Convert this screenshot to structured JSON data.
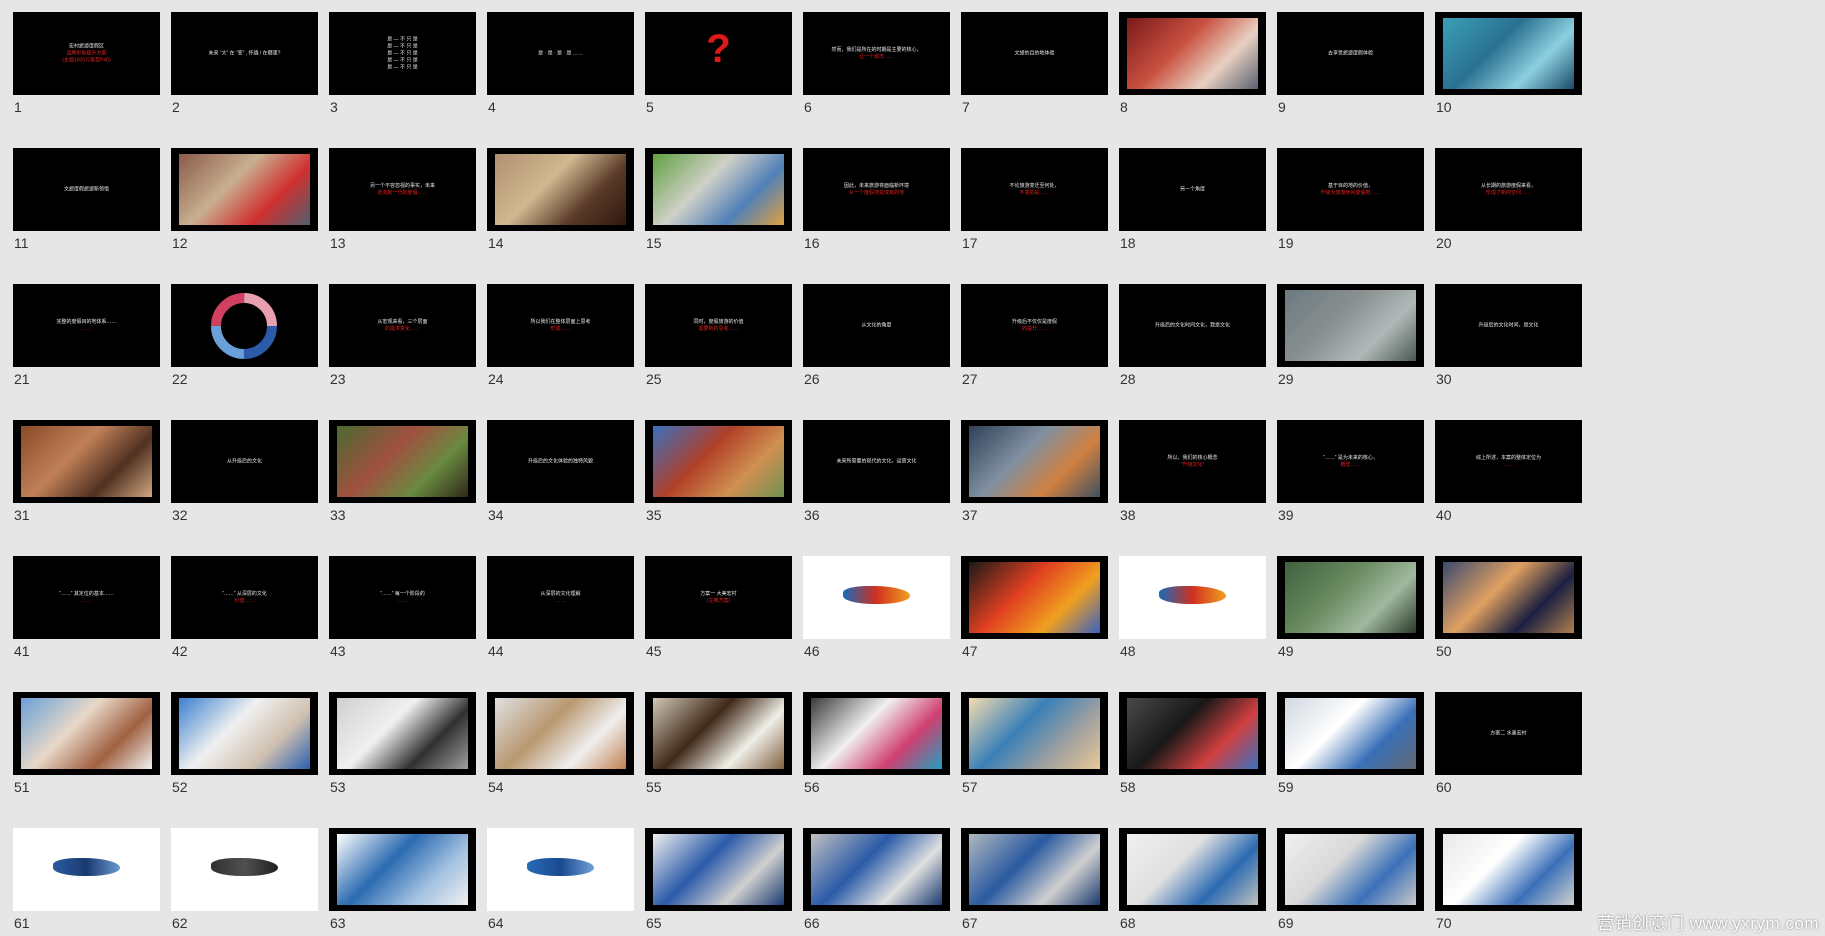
{
  "slides": [
    {
      "n": "1",
      "kind": "text",
      "lines": [
        "宏村旅游度假区",
        "品牌形象提升方案",
        "(主题1000万案至P40)"
      ]
    },
    {
      "n": "2",
      "kind": "text",
      "lines": [
        "未来 “大” 在 “变” , 怀缅 / 在哪里?"
      ]
    },
    {
      "n": "3",
      "kind": "text",
      "lines": [
        "是 — 不 只 是",
        "是 — 不 只 是",
        "是 — 不 只 是",
        "是 — 不 只 是",
        "是 — 不 只 是"
      ]
    },
    {
      "n": "4",
      "kind": "text",
      "lines": [
        "是 · 是 · 是 · 是 ……"
      ]
    },
    {
      "n": "5",
      "kind": "question",
      "lines": [
        "?"
      ]
    },
    {
      "n": "6",
      "kind": "text",
      "lines": [
        "然而，我们是所在的时期是主要的核心，",
        "让一个城市……"
      ]
    },
    {
      "n": "7",
      "kind": "text",
      "lines": [
        "文旅的目的地体验"
      ]
    },
    {
      "n": "8",
      "kind": "photo",
      "colors": [
        "#7a1a1a",
        "#c85040",
        "#e8d0c0",
        "#5a6070"
      ]
    },
    {
      "n": "9",
      "kind": "text",
      "lines": [
        "去享受旅游度假体验"
      ]
    },
    {
      "n": "10",
      "kind": "photo",
      "colors": [
        "#3aa0b8",
        "#2a7090",
        "#8cd0e0",
        "#1a4a68"
      ]
    },
    {
      "n": "11",
      "kind": "text",
      "lines": [
        "文旅度假旅游新领悟"
      ]
    },
    {
      "n": "12",
      "kind": "photo",
      "colors": [
        "#8a5a4a",
        "#c8b090",
        "#d03030",
        "#506070"
      ]
    },
    {
      "n": "13",
      "kind": "text",
      "lines": [
        "另一个不容忽视的事实，未来",
        "走向新一代的度假……"
      ]
    },
    {
      "n": "14",
      "kind": "photo",
      "colors": [
        "#b09070",
        "#d0b890",
        "#5a3a28",
        "#301810"
      ]
    },
    {
      "n": "15",
      "kind": "photo",
      "colors": [
        "#60a040",
        "#d0d0c8",
        "#5080b8",
        "#e0a040"
      ]
    },
    {
      "n": "16",
      "kind": "text",
      "lines": [
        "因此，未来旅游将面临新环境",
        "从一个度假地变成目的地"
      ]
    },
    {
      "n": "17",
      "kind": "text",
      "lines": [
        "不论旅游变迁至何处，",
        "不变的是……"
      ]
    },
    {
      "n": "18",
      "kind": "text",
      "lines": [
        "另一个角度"
      ]
    },
    {
      "n": "19",
      "kind": "text",
      "lines": [
        "基于目的地的价值，",
        "升级为旅游休闲度假地……"
      ]
    },
    {
      "n": "20",
      "kind": "text",
      "lines": [
        "从长期的旅游度假来看，",
        "形成了新的空间……"
      ]
    },
    {
      "n": "21",
      "kind": "text",
      "lines": [
        "完整的度假目的地体系……",
        "……"
      ]
    },
    {
      "n": "22",
      "kind": "donut",
      "colors": [
        "#2a5aa8",
        "#6aa0d8",
        "#d04060",
        "#e8a0b0"
      ]
    },
    {
      "n": "23",
      "kind": "text",
      "lines": [
        "从宏观来看，三个层面",
        "的需求变化……"
      ]
    },
    {
      "n": "24",
      "kind": "text",
      "lines": [
        "所以我们在整体层面上思考",
        "形成……"
      ]
    },
    {
      "n": "25",
      "kind": "text",
      "lines": [
        "同时，度假旅游的价值",
        "需要新的思考……"
      ]
    },
    {
      "n": "26",
      "kind": "text",
      "lines": [
        "从文化的角度"
      ]
    },
    {
      "n": "27",
      "kind": "text",
      "lines": [
        "升级后不仅仅是度假",
        "的提升……"
      ]
    },
    {
      "n": "28",
      "kind": "text",
      "lines": [
        "升级后的文化时间文化，我是文化"
      ]
    },
    {
      "n": "29",
      "kind": "photo",
      "colors": [
        "#6a7a80",
        "#8a9090",
        "#b0b8b8",
        "#4a5a50"
      ]
    },
    {
      "n": "30",
      "kind": "text",
      "lines": [
        "升级后的文化时间，是文化"
      ]
    },
    {
      "n": "31",
      "kind": "photo",
      "colors": [
        "#8a4a28",
        "#c08058",
        "#503020",
        "#d0a880"
      ]
    },
    {
      "n": "32",
      "kind": "text",
      "lines": [
        "从升级后的文化"
      ]
    },
    {
      "n": "33",
      "kind": "photo",
      "colors": [
        "#4a6a30",
        "#a05040",
        "#6a8a40",
        "#302818"
      ]
    },
    {
      "n": "34",
      "kind": "text",
      "lines": [
        "升级后的文化体验的独特风貌"
      ]
    },
    {
      "n": "35",
      "kind": "photo",
      "colors": [
        "#3a70c0",
        "#b04028",
        "#d09050",
        "#709050"
      ]
    },
    {
      "n": "36",
      "kind": "text",
      "lines": [
        "未来所需要的现代的文化，运营文化"
      ]
    },
    {
      "n": "37",
      "kind": "photo",
      "colors": [
        "#304058",
        "#8090a0",
        "#d08040",
        "#405060"
      ]
    },
    {
      "n": "38",
      "kind": "text",
      "lines": [
        "所以，我们的核心概念",
        "“升级文化”"
      ]
    },
    {
      "n": "39",
      "kind": "text",
      "lines": [
        "“……” 是为未来的核心，",
        "概念……"
      ]
    },
    {
      "n": "40",
      "kind": "text",
      "lines": [
        "综上所述，本案的整体定位为",
        "……"
      ]
    },
    {
      "n": "41",
      "kind": "text",
      "lines": [
        "“……” 其定位的基本……",
        "……"
      ]
    },
    {
      "n": "42",
      "kind": "text",
      "lines": [
        "“……” 从深层的文化",
        "价值……"
      ]
    },
    {
      "n": "43",
      "kind": "text",
      "lines": [
        "“……” 每一个阶段的",
        "……"
      ]
    },
    {
      "n": "44",
      "kind": "text",
      "lines": [
        "从深层的文化理解",
        "……"
      ]
    },
    {
      "n": "45",
      "kind": "text",
      "lines": [
        "方案一 大美宏村",
        "(主推方案)"
      ]
    },
    {
      "n": "46",
      "kind": "logo-white",
      "colors": [
        "#1a6ab8",
        "#d03020",
        "#f0a020"
      ]
    },
    {
      "n": "47",
      "kind": "photo",
      "colors": [
        "#1a1a1a",
        "#e04020",
        "#f0a020",
        "#3a60c0"
      ]
    },
    {
      "n": "48",
      "kind": "logo-white",
      "colors": [
        "#1a6ab8",
        "#d03020",
        "#f0a020"
      ]
    },
    {
      "n": "49",
      "kind": "photo",
      "colors": [
        "#406040",
        "#6a8a60",
        "#a0b8a0",
        "#2a3a28"
      ]
    },
    {
      "n": "50",
      "kind": "photo",
      "colors": [
        "#3a4a70",
        "#e0a060",
        "#1a2040",
        "#b08050"
      ]
    },
    {
      "n": "51",
      "kind": "photo",
      "colors": [
        "#6aa0d8",
        "#e8d8c8",
        "#a06040",
        "#f0f0f0"
      ]
    },
    {
      "n": "52",
      "kind": "photo",
      "colors": [
        "#3a80d0",
        "#f0f0f0",
        "#d0c0b0",
        "#2a60b0"
      ]
    },
    {
      "n": "53",
      "kind": "photo",
      "colors": [
        "#d0d0d0",
        "#f0f0f0",
        "#303030",
        "#a0a0a0"
      ]
    },
    {
      "n": "54",
      "kind": "photo",
      "colors": [
        "#e0e0e0",
        "#b89870",
        "#f0f0f0",
        "#c08050"
      ]
    },
    {
      "n": "55",
      "kind": "photo",
      "colors": [
        "#d0c8b8",
        "#402818",
        "#f0f0e8",
        "#806040"
      ]
    },
    {
      "n": "56",
      "kind": "photo",
      "colors": [
        "#3a3a3a",
        "#f0f0f0",
        "#d04070",
        "#20a0c0"
      ]
    },
    {
      "n": "57",
      "kind": "photo",
      "colors": [
        "#f5dcb0",
        "#3a80b8",
        "#a0a0a0",
        "#e8c898"
      ]
    },
    {
      "n": "58",
      "kind": "photo",
      "colors": [
        "#4a4a4a",
        "#181818",
        "#d04040",
        "#3a70c0"
      ]
    },
    {
      "n": "59",
      "kind": "photo",
      "colors": [
        "#d0d8e0",
        "#ffffff",
        "#3a70b8",
        "#606870"
      ]
    },
    {
      "n": "60",
      "kind": "text",
      "lines": [
        "方案二 水墨宏村"
      ]
    },
    {
      "n": "61",
      "kind": "logo-white",
      "colors": [
        "#2a5aa0",
        "#1a3a70",
        "#6a9ad0"
      ]
    },
    {
      "n": "62",
      "kind": "logo-white",
      "colors": [
        "#303030",
        "#505050",
        "#202020"
      ]
    },
    {
      "n": "63",
      "kind": "photo",
      "colors": [
        "#ffffff",
        "#2a6ab0",
        "#a0c0e0",
        "#f0f0f0"
      ]
    },
    {
      "n": "64",
      "kind": "logo-white",
      "colors": [
        "#2a6ab8",
        "#1a4a90",
        "#70a0d8"
      ]
    },
    {
      "n": "65",
      "kind": "photo",
      "colors": [
        "#f0f0f0",
        "#2a5aa8",
        "#d0d0d0",
        "#1a3a70"
      ]
    },
    {
      "n": "66",
      "kind": "photo",
      "colors": [
        "#c0c0c0",
        "#2a5aa8",
        "#e0e0e0",
        "#1a3a70"
      ]
    },
    {
      "n": "67",
      "kind": "photo",
      "colors": [
        "#b0b8c0",
        "#2a5aa0",
        "#d0d0d0",
        "#1a3a70"
      ]
    },
    {
      "n": "68",
      "kind": "photo",
      "colors": [
        "#f0f0f0",
        "#e0e0e0",
        "#2a6ab0",
        "#c0c0c0"
      ]
    },
    {
      "n": "69",
      "kind": "photo",
      "colors": [
        "#f0f0f0",
        "#d8d8d8",
        "#3a70b8",
        "#c8c8c8"
      ]
    },
    {
      "n": "70",
      "kind": "photo",
      "colors": [
        "#e8e8e8",
        "#ffffff",
        "#3a70b8",
        "#d0d0d0"
      ]
    }
  ],
  "watermark": "营销创意门 www.yxrym.com",
  "colors": {
    "background": "#e6e6e6",
    "slide_bg": "#000000",
    "accent": "#e02020"
  }
}
